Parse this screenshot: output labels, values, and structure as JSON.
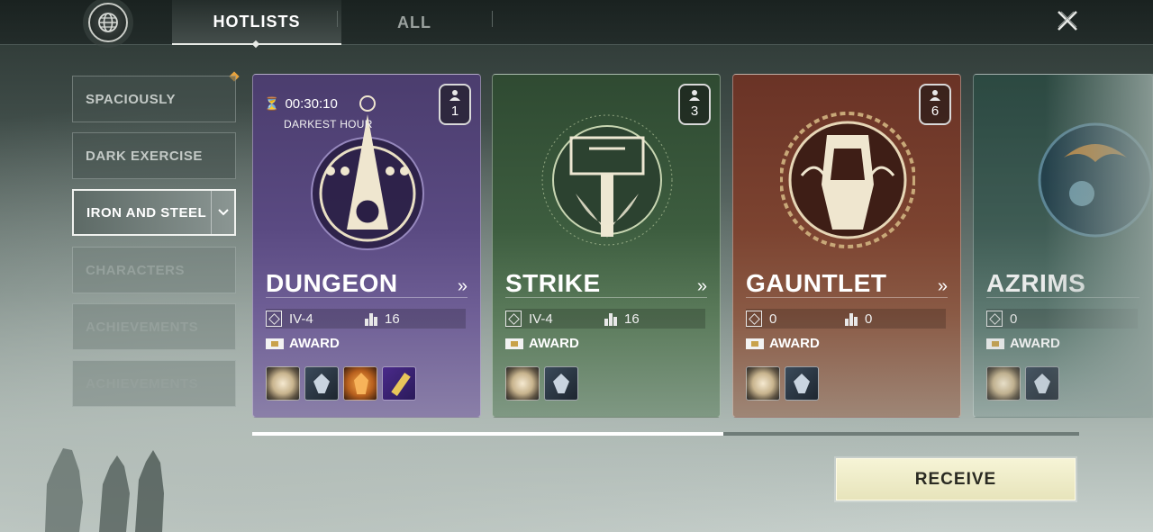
{
  "header": {
    "tabs": [
      {
        "label": "HOTLISTS",
        "active": true
      },
      {
        "label": "ALL",
        "active": false
      }
    ]
  },
  "sidebar": {
    "items": [
      {
        "label": "SPACIOUSLY",
        "state": "normal",
        "has_notification": true
      },
      {
        "label": "DARK EXERCISE",
        "state": "normal"
      },
      {
        "label": "IRON AND STEEL",
        "state": "active"
      },
      {
        "label": "CHARACTERS",
        "state": "dim"
      },
      {
        "label": "ACHIEVEMENTS",
        "state": "dim"
      },
      {
        "label": "ACHIEVEMENTS",
        "state": "dim"
      }
    ]
  },
  "cards": [
    {
      "title": "DUNGEON",
      "players": "1",
      "timer": "00:30:10",
      "timer_label": "DARKEST HOUR",
      "difficulty": "IV-4",
      "power": "16",
      "award_label": "AWARD",
      "rewards": [
        "orb-icon",
        "shard-icon",
        "amber-icon",
        "key-icon"
      ],
      "theme_color": "#5a4a82"
    },
    {
      "title": "STRIKE",
      "players": "3",
      "difficulty": "IV-4",
      "power": "16",
      "award_label": "AWARD",
      "rewards": [
        "orb-icon",
        "shard-icon"
      ],
      "theme_color": "#3d5d3f"
    },
    {
      "title": "GAUNTLET",
      "players": "6",
      "difficulty": "0",
      "power": "0",
      "award_label": "AWARD",
      "rewards": [
        "orb-icon",
        "shard-icon"
      ],
      "theme_color": "#7c4330"
    },
    {
      "title": "AZRIMS",
      "difficulty": "0",
      "award_label": "AWARD",
      "rewards": [
        "orb-icon",
        "shard-icon"
      ],
      "theme_color": "#3a5a52"
    }
  ],
  "scroll_progress": 0.57,
  "receive_label": "RECEIVE",
  "colors": {
    "accent": "#e8a23c",
    "receive_bg": "#f6f4d6"
  }
}
